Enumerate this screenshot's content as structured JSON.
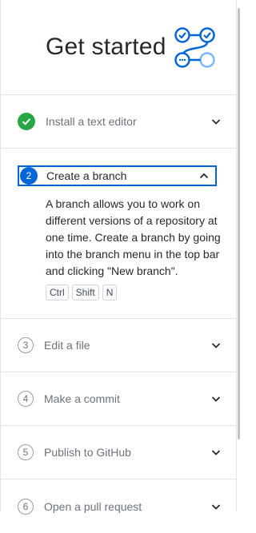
{
  "header": {
    "title": "Get started"
  },
  "steps": [
    {
      "num": "",
      "label": "Install a text editor",
      "state": "done"
    },
    {
      "num": "2",
      "label": "Create a branch",
      "state": "active",
      "description": "A branch allows you to work on different versions of a repository at one time. Create a branch by going into the branch menu in the top bar and clicking \"New branch\".",
      "shortcut": [
        "Ctrl",
        "Shift",
        "N"
      ]
    },
    {
      "num": "3",
      "label": "Edit a file",
      "state": "pending"
    },
    {
      "num": "4",
      "label": "Make a commit",
      "state": "pending"
    },
    {
      "num": "5",
      "label": "Publish to GitHub",
      "state": "pending"
    },
    {
      "num": "6",
      "label": "Open a pull request",
      "state": "pending"
    }
  ],
  "colors": {
    "accent": "#0366d6",
    "success": "#28a745",
    "border": "#e1e4e8"
  }
}
